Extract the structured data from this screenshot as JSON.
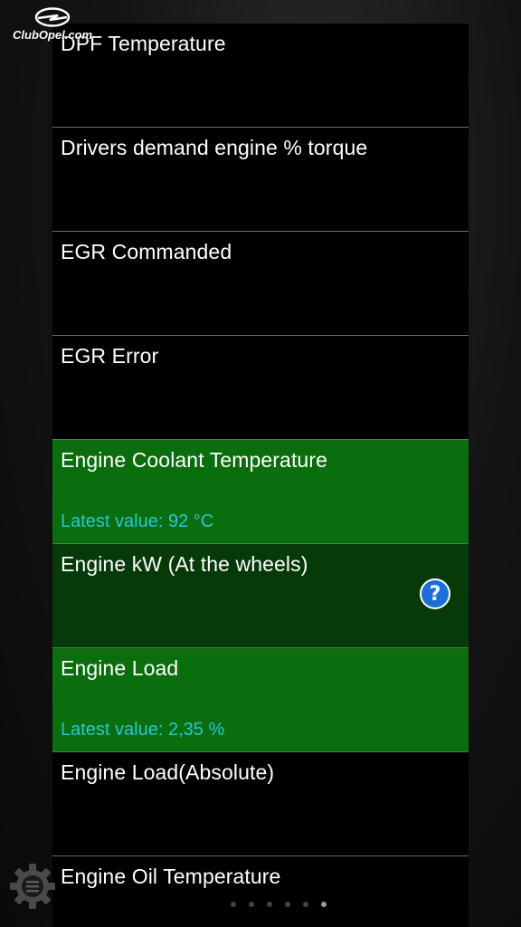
{
  "watermark": {
    "text": "ClubOpel.com"
  },
  "sensors": [
    {
      "title": "DPF Temperature",
      "state": "normal"
    },
    {
      "title": "Drivers demand engine % torque",
      "state": "normal"
    },
    {
      "title": "EGR Commanded",
      "state": "normal"
    },
    {
      "title": "EGR Error",
      "state": "normal"
    },
    {
      "title": "Engine Coolant Temperature",
      "state": "active",
      "value": "Latest value: 92 °C"
    },
    {
      "title": "Engine kW (At the wheels)",
      "state": "partial",
      "help": "?"
    },
    {
      "title": "Engine Load",
      "state": "active",
      "value": "Latest value: 2,35 %"
    },
    {
      "title": "Engine Load(Absolute)",
      "state": "normal"
    },
    {
      "title": "Engine Oil Temperature",
      "state": "normal"
    }
  ],
  "icons": {
    "settings": "gear-menu-icon",
    "help": "help-icon"
  },
  "colors": {
    "active_row": "#0a6e0c",
    "partial_row": "#063a08",
    "value_text": "#29c6d6",
    "help_bg": "#1d6fd8"
  },
  "pager": {
    "count": 6,
    "current": 6
  }
}
